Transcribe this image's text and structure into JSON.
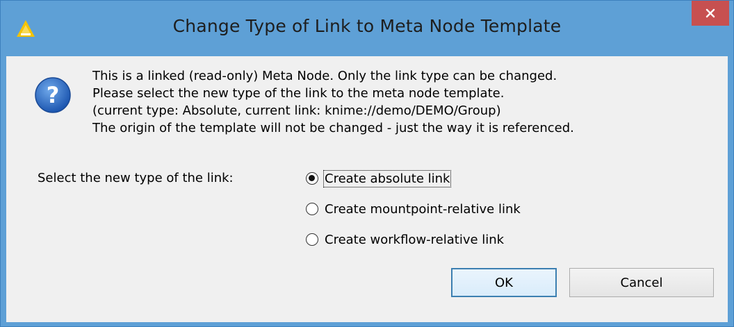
{
  "window": {
    "title": "Change Type of Link to Meta Node Template",
    "app_icon": "knime-icon",
    "close_icon": "close-icon"
  },
  "dialog": {
    "icon": "question-icon",
    "message_lines": [
      "This is a linked (read-only) Meta Node. Only the link type can be changed.",
      "Please select the new type of the link to the meta node template.",
      "(current type: Absolute, current link: knime://demo/DEMO/Group)",
      "The origin of the template will not be changed - just the way it is referenced."
    ],
    "select_label": "Select the new type of the link:",
    "options": [
      {
        "label": "Create absolute link",
        "checked": true
      },
      {
        "label": "Create mountpoint-relative link",
        "checked": false
      },
      {
        "label": "Create workflow-relative link",
        "checked": false
      }
    ],
    "buttons": {
      "ok": "OK",
      "cancel": "Cancel"
    }
  },
  "colors": {
    "frame": "#5ea0d6",
    "close_button": "#c75050",
    "client_background": "#f0f0f0",
    "default_button_border": "#3c7fb1"
  }
}
